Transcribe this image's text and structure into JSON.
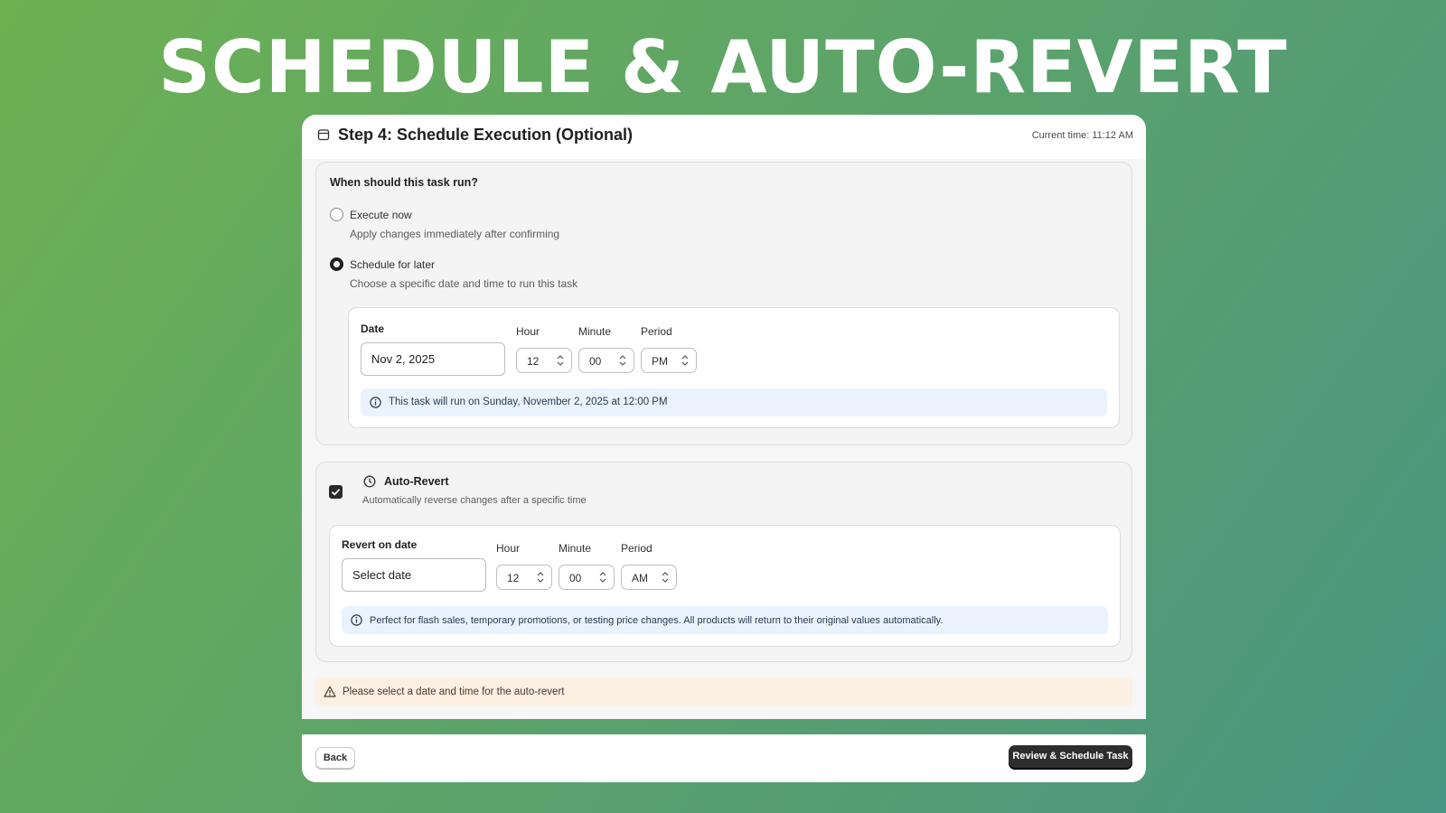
{
  "hero": {
    "title": "SCHEDULE & AUTO-REVERT"
  },
  "header": {
    "title": "Step 4: Schedule Execution (Optional)",
    "current_time": "Current time: 11:12 AM"
  },
  "schedule": {
    "question": "When should this task run?",
    "options": [
      {
        "label": "Execute now",
        "help": "Apply changes immediately after confirming",
        "selected": false
      },
      {
        "label": "Schedule for later",
        "help": "Choose a specific date and time to run this task",
        "selected": true
      }
    ],
    "date_label": "Date",
    "date_value": "Nov 2, 2025",
    "hour_label": "Hour",
    "hour_value": "12",
    "minute_label": "Minute",
    "minute_value": "00",
    "period_label": "Period",
    "period_value": "PM",
    "info": "This task will run on Sunday, November 2, 2025 at 12:00 PM"
  },
  "auto_revert": {
    "checked": true,
    "title": "Auto-Revert",
    "description": "Automatically reverse changes after a specific time",
    "date_label": "Revert on date",
    "date_placeholder": "Select date",
    "hour_label": "Hour",
    "hour_value": "12",
    "minute_label": "Minute",
    "minute_value": "00",
    "period_label": "Period",
    "period_value": "AM",
    "info": "Perfect for flash sales, temporary promotions, or testing price changes. All products will return to their original values automatically."
  },
  "warning": "Please select a date and time for the auto-revert",
  "footer": {
    "back_label": "Back",
    "primary_label": "Review & Schedule Task"
  },
  "icons": {
    "header": "calendar-icon",
    "info": "info-icon",
    "auto_revert": "clock-icon",
    "warning": "warning-icon",
    "select": "chevron-up-down-icon"
  },
  "colors": {
    "background_start": "#6db152",
    "background_end": "#4a9582",
    "info_bg": "#eaf3fd",
    "warning_bg": "#fcefe3",
    "primary_button": "#2e2e2e"
  }
}
